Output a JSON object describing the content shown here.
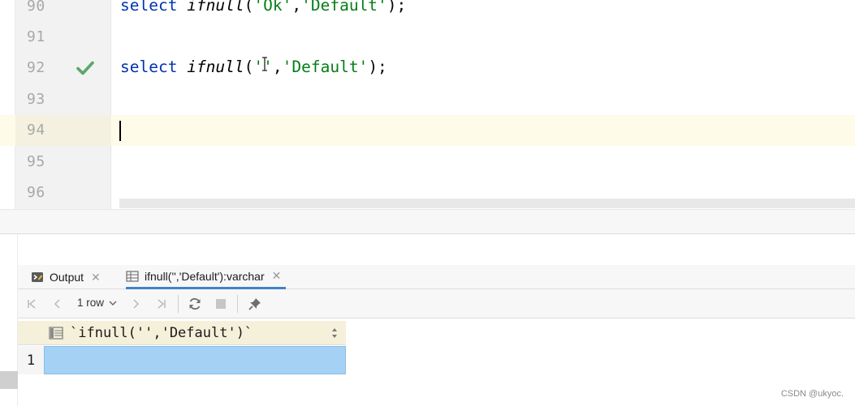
{
  "editor": {
    "lines": [
      {
        "num": "90",
        "kw": "select",
        "fn": "ifnull",
        "open": "(",
        "arg1": "'Ok'",
        "comma": ",",
        "arg2": "'Default'",
        "close": ");"
      },
      {
        "num": "91"
      },
      {
        "num": "92",
        "kw": "select",
        "fn": "ifnull",
        "open": "(",
        "arg1": "''",
        "comma": ",",
        "arg2": "'Default'",
        "close": ");",
        "status": "check-icon"
      },
      {
        "num": "93"
      },
      {
        "num": "94",
        "current": true
      },
      {
        "num": "95"
      },
      {
        "num": "96"
      }
    ]
  },
  "tool_window": {
    "tabs": [
      {
        "label": "Output",
        "icon": "console-icon",
        "close": "✕"
      },
      {
        "label": "ifnull('','Default'):varchar",
        "icon": "table-icon",
        "close": "✕"
      }
    ],
    "toolbar": {
      "row_count": "1 row",
      "icons": [
        "first-page-icon",
        "prev-page-icon",
        "next-page-icon",
        "last-page-icon",
        "refresh-icon",
        "stop-icon",
        "pin-icon"
      ]
    },
    "grid": {
      "column": "`ifnull('','Default')`",
      "rows": [
        {
          "num": "1",
          "value": ""
        }
      ]
    }
  },
  "colors": {
    "keyword": "#0033b3",
    "string": "#067d17",
    "selection": "#a5d1f5",
    "current_line": "#fefbe9",
    "success": "#59a869"
  },
  "watermark": "CSDN @ukyoc."
}
